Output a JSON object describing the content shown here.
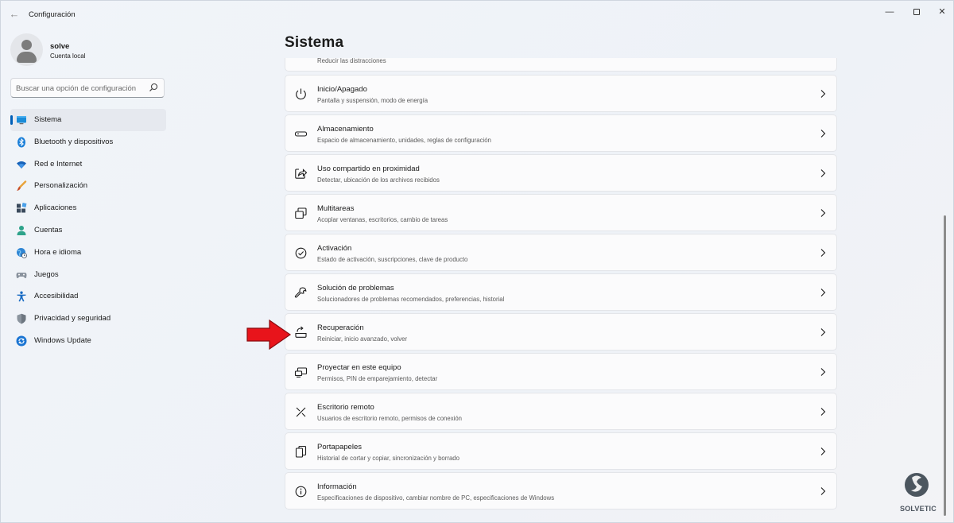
{
  "window": {
    "title": "Configuración",
    "controls": [
      "minimize",
      "maximize",
      "close"
    ]
  },
  "profile": {
    "name": "solve",
    "account_type": "Cuenta local"
  },
  "search": {
    "placeholder": "Buscar una opción de configuración"
  },
  "sidebar": {
    "items": [
      {
        "label": "Sistema",
        "icon": "monitor-icon",
        "active": true
      },
      {
        "label": "Bluetooth y dispositivos",
        "icon": "bluetooth-icon",
        "active": false
      },
      {
        "label": "Red e Internet",
        "icon": "wifi-icon",
        "active": false
      },
      {
        "label": "Personalización",
        "icon": "brush-icon",
        "active": false
      },
      {
        "label": "Aplicaciones",
        "icon": "apps-icon",
        "active": false
      },
      {
        "label": "Cuentas",
        "icon": "person-icon",
        "active": false
      },
      {
        "label": "Hora e idioma",
        "icon": "globe-clock-icon",
        "active": false
      },
      {
        "label": "Juegos",
        "icon": "gamepad-icon",
        "active": false
      },
      {
        "label": "Accesibilidad",
        "icon": "accessibility-icon",
        "active": false
      },
      {
        "label": "Privacidad y seguridad",
        "icon": "shield-icon",
        "active": false
      },
      {
        "label": "Windows Update",
        "icon": "update-icon",
        "active": false
      }
    ]
  },
  "main": {
    "title": "Sistema",
    "partial_card_subtitle": "Reducir las distracciones",
    "cards": [
      {
        "title": "Inicio/Apagado",
        "subtitle": "Pantalla y suspensión, modo de energía",
        "icon": "power-icon"
      },
      {
        "title": "Almacenamiento",
        "subtitle": "Espacio de almacenamiento, unidades, reglas de configuración",
        "icon": "storage-icon"
      },
      {
        "title": "Uso compartido en proximidad",
        "subtitle": "Detectar, ubicación de los archivos recibidos",
        "icon": "share-icon"
      },
      {
        "title": "Multitareas",
        "subtitle": "Acoplar ventanas, escritorios, cambio de tareas",
        "icon": "multitask-icon"
      },
      {
        "title": "Activación",
        "subtitle": "Estado de activación, suscripciones, clave de producto",
        "icon": "check-circle-icon"
      },
      {
        "title": "Solución de problemas",
        "subtitle": "Solucionadores de problemas recomendados, preferencias, historial",
        "icon": "wrench-icon"
      },
      {
        "title": "Recuperación",
        "subtitle": "Reiniciar, inicio avanzado, volver",
        "icon": "recovery-icon"
      },
      {
        "title": "Proyectar en este equipo",
        "subtitle": "Permisos, PIN de emparejamiento, detectar",
        "icon": "project-icon"
      },
      {
        "title": "Escritorio remoto",
        "subtitle": "Usuarios de escritorio remoto, permisos de conexión",
        "icon": "remote-desktop-icon"
      },
      {
        "title": "Portapapeles",
        "subtitle": "Historial de cortar y copiar, sincronización y borrado",
        "icon": "clipboard-icon"
      },
      {
        "title": "Información",
        "subtitle": "Especificaciones de dispositivo, cambiar nombre de PC, especificaciones de Windows",
        "icon": "info-icon"
      }
    ]
  },
  "annotation": {
    "arrow_color": "#e8141b",
    "points_to": "Recuperación"
  },
  "watermark": {
    "text": "SOLVETIC"
  },
  "colors": {
    "accent": "#005fb8",
    "background": "#eef2f7",
    "card": "#fbfbfc"
  }
}
